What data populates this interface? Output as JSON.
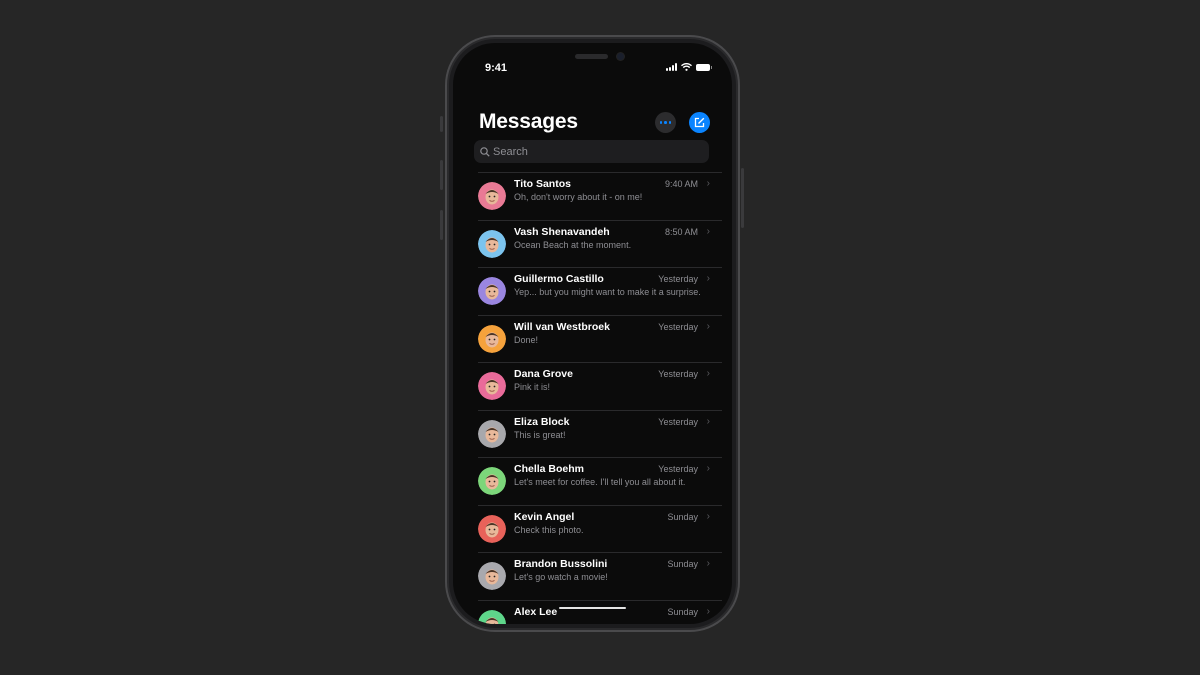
{
  "status_bar": {
    "time": "9:41"
  },
  "header": {
    "title": "Messages",
    "more_icon": "ellipsis-icon",
    "compose_icon": "compose-icon"
  },
  "search": {
    "placeholder": "Search",
    "value": ""
  },
  "colors": {
    "accent": "#0a84ff",
    "background": "#0b0b0b",
    "secondary_text": "#8e8e93"
  },
  "conversations": [
    {
      "name": "Tito Santos",
      "preview": "Oh, don't worry about it - on me!",
      "time": "9:40 AM",
      "avatar_color": "#e97a95"
    },
    {
      "name": "Vash Shenavandeh",
      "preview": "Ocean Beach at the moment.",
      "time": "8:50 AM",
      "avatar_color": "#7cc4ee"
    },
    {
      "name": "Guillermo Castillo",
      "preview": "Yep... but you might want to make it a surprise.",
      "time": "Yesterday",
      "avatar_color": "#9a86e0"
    },
    {
      "name": "Will van Westbroek",
      "preview": "Done!",
      "time": "Yesterday",
      "avatar_color": "#f5a23c"
    },
    {
      "name": "Dana Grove",
      "preview": "Pink it is!",
      "time": "Yesterday",
      "avatar_color": "#e96b9a"
    },
    {
      "name": "Eliza Block",
      "preview": "This is great!",
      "time": "Yesterday",
      "avatar_color": "#a8a8ac"
    },
    {
      "name": "Chella Boehm",
      "preview": "Let's meet for coffee. I'll tell you all about it.",
      "time": "Yesterday",
      "avatar_color": "#7cd67a"
    },
    {
      "name": "Kevin Angel",
      "preview": "Check this photo.",
      "time": "Sunday",
      "avatar_color": "#e8625a"
    },
    {
      "name": "Brandon Bussolini",
      "preview": "Let's go watch a movie!",
      "time": "Sunday",
      "avatar_color": "#a9a9ae"
    },
    {
      "name": "Alex Lee",
      "preview": "",
      "time": "Sunday",
      "avatar_color": "#5ed68a"
    }
  ]
}
